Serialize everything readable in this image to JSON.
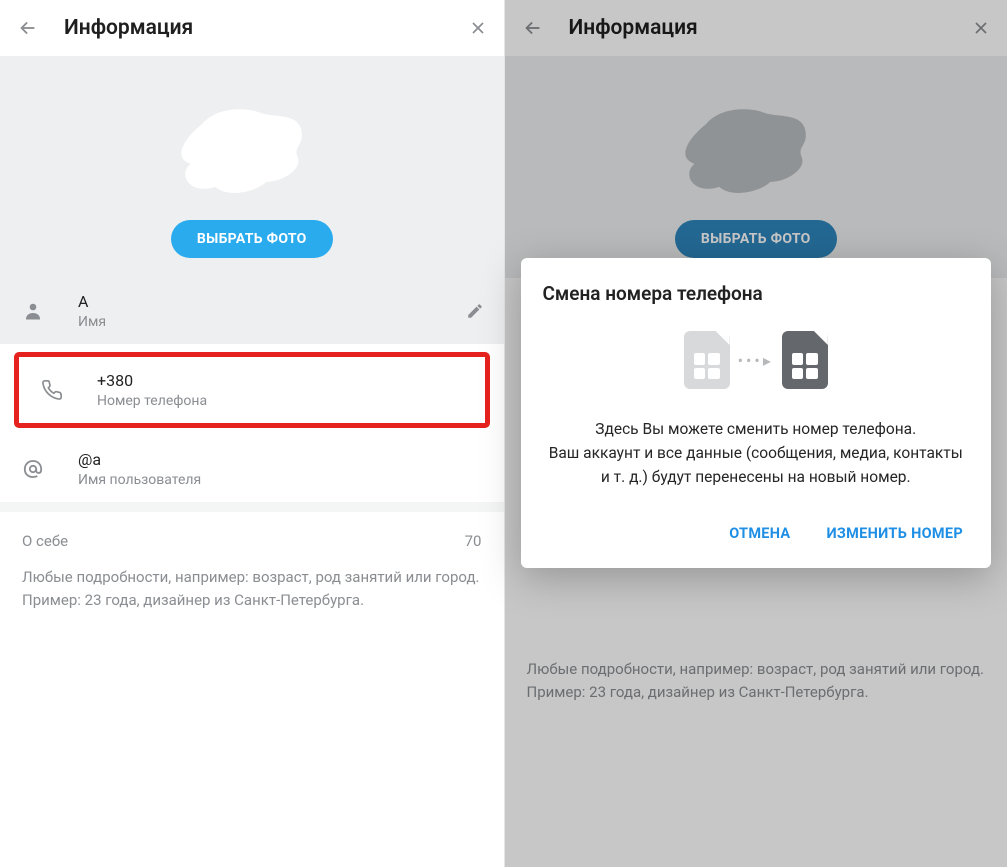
{
  "left": {
    "header_title": "Информация",
    "choose_photo": "ВЫБРАТЬ ФОТО",
    "name_value": "А",
    "name_label": "Имя",
    "phone_value": "+380",
    "phone_label": "Номер телефона",
    "username_value": "@a",
    "username_label": "Имя пользователя",
    "about_label": "О себе",
    "about_limit": "70",
    "hint_line1": "Любые подробности, например: возраст, род занятий или город.",
    "hint_line2": "Пример: 23 года, дизайнер из Санкт-Петербурга."
  },
  "right": {
    "header_title": "Информация",
    "choose_photo": "ВЫБРАТЬ ФОТО",
    "hint_line1": "Любые подробности, например: возраст, род занятий или город.",
    "hint_line2": "Пример: 23 года, дизайнер из Санкт-Петербурга."
  },
  "dialog": {
    "title": "Смена номера телефона",
    "body_l1": "Здесь Вы можете сменить номер телефона.",
    "body_l2": "Ваш аккаунт и все данные (сообщения, медиа, контакты",
    "body_l3": "и т. д.) будут перенесены на новый номер.",
    "cancel": "ОТМЕНА",
    "change": "ИЗМЕНИТЬ НОМЕР"
  }
}
